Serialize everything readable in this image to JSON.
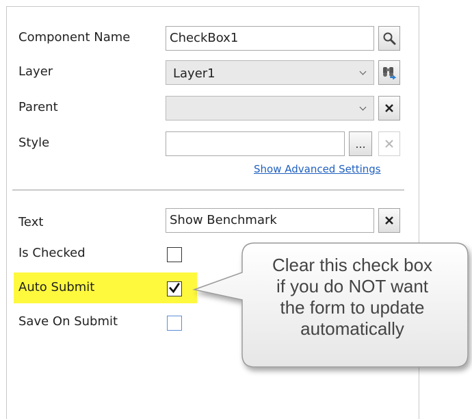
{
  "props": {
    "component_name": {
      "label": "Component Name",
      "value": "CheckBox1"
    },
    "layer": {
      "label": "Layer",
      "value": "Layer1"
    },
    "parent": {
      "label": "Parent",
      "value": ""
    },
    "style": {
      "label": "Style",
      "value": "",
      "ellipsis": "..."
    },
    "advanced_link": "Show Advanced Settings"
  },
  "checkbox_props": {
    "text": {
      "label": "Text",
      "value": "Show Benchmark"
    },
    "is_checked": {
      "label": "Is Checked",
      "checked": false
    },
    "auto_submit": {
      "label": "Auto Submit",
      "checked": true,
      "highlight": "#fff93e"
    },
    "save_on_submit": {
      "label": "Save On Submit",
      "checked": false
    }
  },
  "callout": {
    "lines": [
      "Clear this check box",
      "if you do NOT want",
      "the form to update",
      "automatically"
    ]
  },
  "icons": {
    "find": "magnifier-icon",
    "layer_action": "binoculars-icon",
    "clear": "close-icon",
    "disabled_clear": "close-icon-disabled",
    "check": "check-icon"
  }
}
